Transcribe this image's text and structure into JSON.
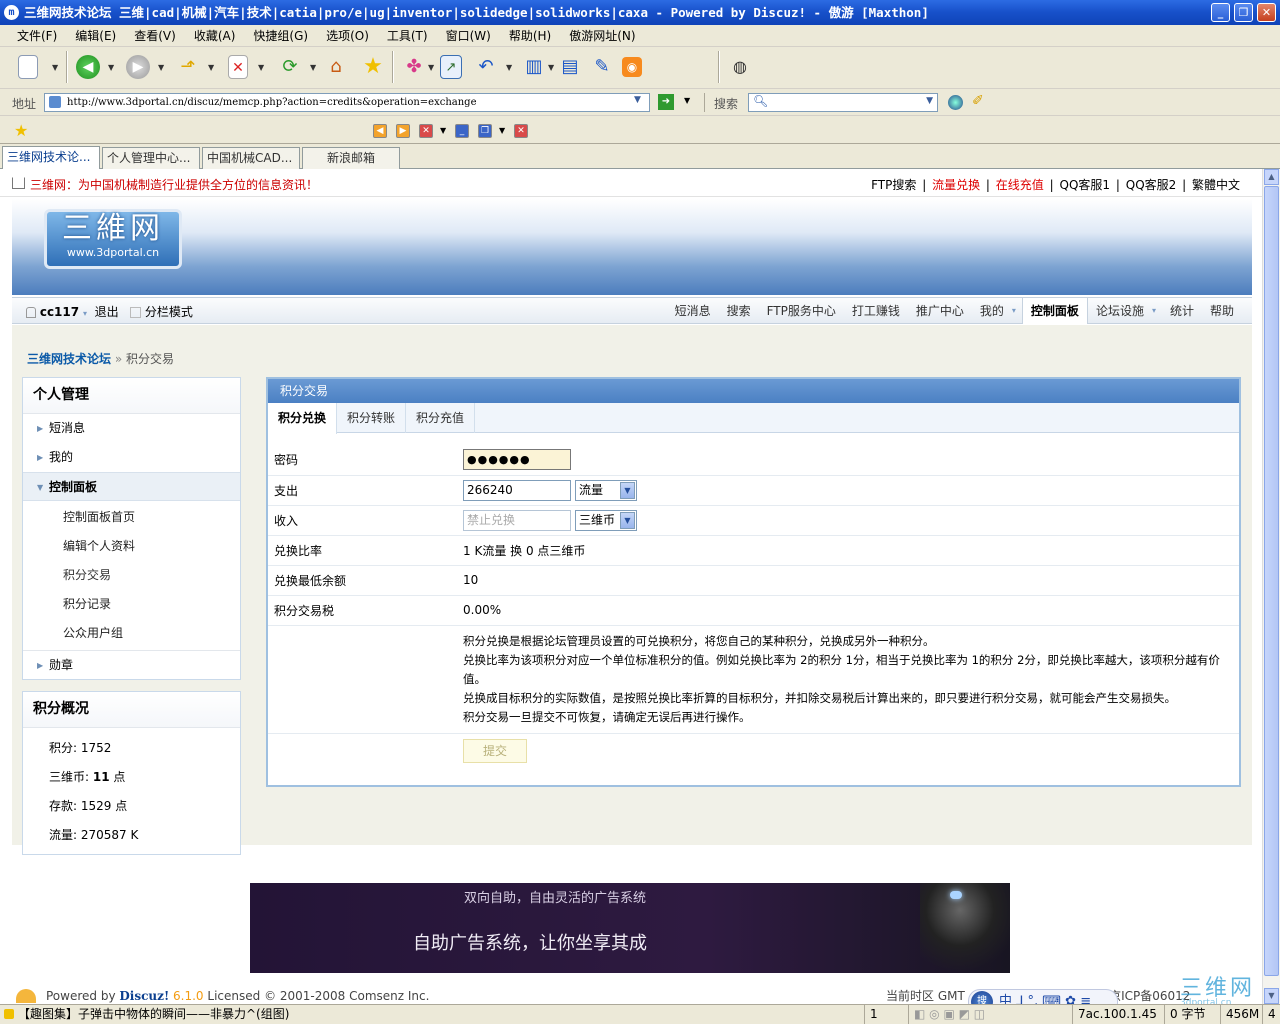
{
  "window": {
    "title": "三维网技术论坛 三维|cad|机械|汽车|技术|catia|pro/e|ug|inventor|solidedge|solidworks|caxa - Powered by Discuz! - 傲游 [Maxthon]",
    "app_icon": "m",
    "controls": {
      "minimize": "_",
      "restore": "❐",
      "close": "✕"
    }
  },
  "menubar": [
    "文件(F)",
    "编辑(E)",
    "查看(V)",
    "收藏(A)",
    "快捷组(G)",
    "选项(O)",
    "工具(T)",
    "窗口(W)",
    "帮助(H)",
    "傲游网址(N)"
  ],
  "toolbar": {
    "icons": [
      "new-page-icon",
      "back-icon",
      "forward-icon",
      "up-icon",
      "stop-icon",
      "refresh-icon",
      "home-icon",
      "favorites-star-icon",
      "groups-icon",
      "window-icon",
      "undo-icon",
      "columns-icon",
      "list-icon",
      "edit-icon",
      "rss-icon",
      "compass-icon"
    ]
  },
  "addressbar": {
    "label": "地址",
    "url": "http://www.3dportal.cn/discuz/memcp.php?action=credits&operation=exchange",
    "search_label": "搜索"
  },
  "tabs": [
    {
      "label": "三维网技术论...",
      "active": true
    },
    {
      "label": "个人管理中心...",
      "active": false
    },
    {
      "label": "中国机械CAD...",
      "active": false
    },
    {
      "label": "新浪邮箱",
      "active": false
    }
  ],
  "site": {
    "slogan": "三维网：为中国机械制造行业提供全方位的信息资讯！",
    "toplinks": [
      {
        "label": "FTP搜索",
        "red": false
      },
      {
        "label": "|",
        "red": false
      },
      {
        "label": "流量兑换",
        "red": true
      },
      {
        "label": "|",
        "red": false
      },
      {
        "label": "在线充值",
        "red": true
      },
      {
        "label": "|",
        "red": false
      },
      {
        "label": "QQ客服1",
        "red": false
      },
      {
        "label": "|",
        "red": false
      },
      {
        "label": "QQ客服2",
        "red": false
      },
      {
        "label": "|",
        "red": false
      },
      {
        "label": "繁體中文",
        "red": false
      }
    ],
    "logo": {
      "big": "三維网",
      "small": "www.3dportal.cn"
    }
  },
  "navbar": {
    "username": "cc117",
    "logout": "退出",
    "split_mode": "分栏模式",
    "items": [
      "短消息",
      "搜索",
      "FTP服务中心",
      "打工赚钱",
      "推广中心",
      "我的",
      "控制面板",
      "论坛设施",
      "统计",
      "帮助"
    ],
    "active": "控制面板"
  },
  "breadcrumb": {
    "home": "三维网技术论坛",
    "sep": "»",
    "current": "积分交易"
  },
  "sidebar": {
    "title": "个人管理",
    "items": [
      {
        "label": "短消息",
        "open": false
      },
      {
        "label": "我的",
        "open": false
      },
      {
        "label": "控制面板",
        "open": true
      }
    ],
    "subitems": [
      "控制面板首页",
      "编辑个人资料",
      "积分交易",
      "积分记录",
      "公众用户组"
    ],
    "after": "勋章"
  },
  "summary": {
    "title": "积分概况",
    "rows": [
      {
        "label": "积分: 1752"
      },
      {
        "label_prefix": "三维币: ",
        "value": "11",
        "suffix": " 点"
      },
      {
        "label": "存款: 1529 点"
      },
      {
        "label": "流量: 270587 K"
      }
    ]
  },
  "panel": {
    "title": "积分交易",
    "tabs": [
      "积分兑换",
      "积分转账",
      "积分充值"
    ],
    "active_tab": "积分兑换",
    "form": {
      "password_label": "密码",
      "password_value": "●●●●●●",
      "spend_label": "支出",
      "spend_value": "266240",
      "spend_unit": "流量",
      "income_label": "收入",
      "income_placeholder": "禁止兑换",
      "income_unit": "三维币",
      "ratio_label": "兑换比率",
      "ratio_value": "1 K流量 换 0 点三维币",
      "min_label": "兑换最低余额",
      "min_value": "10",
      "tax_label": "积分交易税",
      "tax_value": "0.00%"
    },
    "notes": [
      "积分兑换是根据论坛管理员设置的可兑换积分，将您自己的某种积分，兑换成另外一种积分。",
      "兑换比率为该项积分对应一个单位标准积分的值。例如兑换比率为 2的积分 1分，相当于兑换比率为 1的积分 2分，即兑换比率越大，该项积分越有价值。",
      "兑换成目标积分的实际数值，是按照兑换比率折算的目标积分，并扣除交易税后计算出来的，即只要进行积分交易，就可能会产生交易损失。",
      "积分交易一旦提交不可恢复，请确定无误后再进行操作。"
    ],
    "submit": "提交"
  },
  "ad": {
    "line1": "双向自助，自由灵活的广告系统",
    "line2": "自助广告系统，让你坐享其成"
  },
  "footer": {
    "powered_prefix": "Powered by ",
    "brand": "Discuz!",
    "version": " 6.1.0",
    "license": " Licensed © 2001-2008 Comsenz Inc.",
    "timezone": "当前时区 GMT",
    "icp": "03 京ICP备06012"
  },
  "ime": {
    "logo": "搜",
    "text": "中 ⅃ °, ⌨ ✿ ≡"
  },
  "watermark": {
    "big": "三维网",
    "small": "3dportal.cn"
  },
  "statusbar": {
    "text": "【趣图集】子弹击中物体的瞬间——非暴力^(组图)",
    "seg1": "1",
    "seg2": "7ac.100.1.45",
    "seg3": "0 字节",
    "seg4": "456M",
    "seg5": "4"
  }
}
